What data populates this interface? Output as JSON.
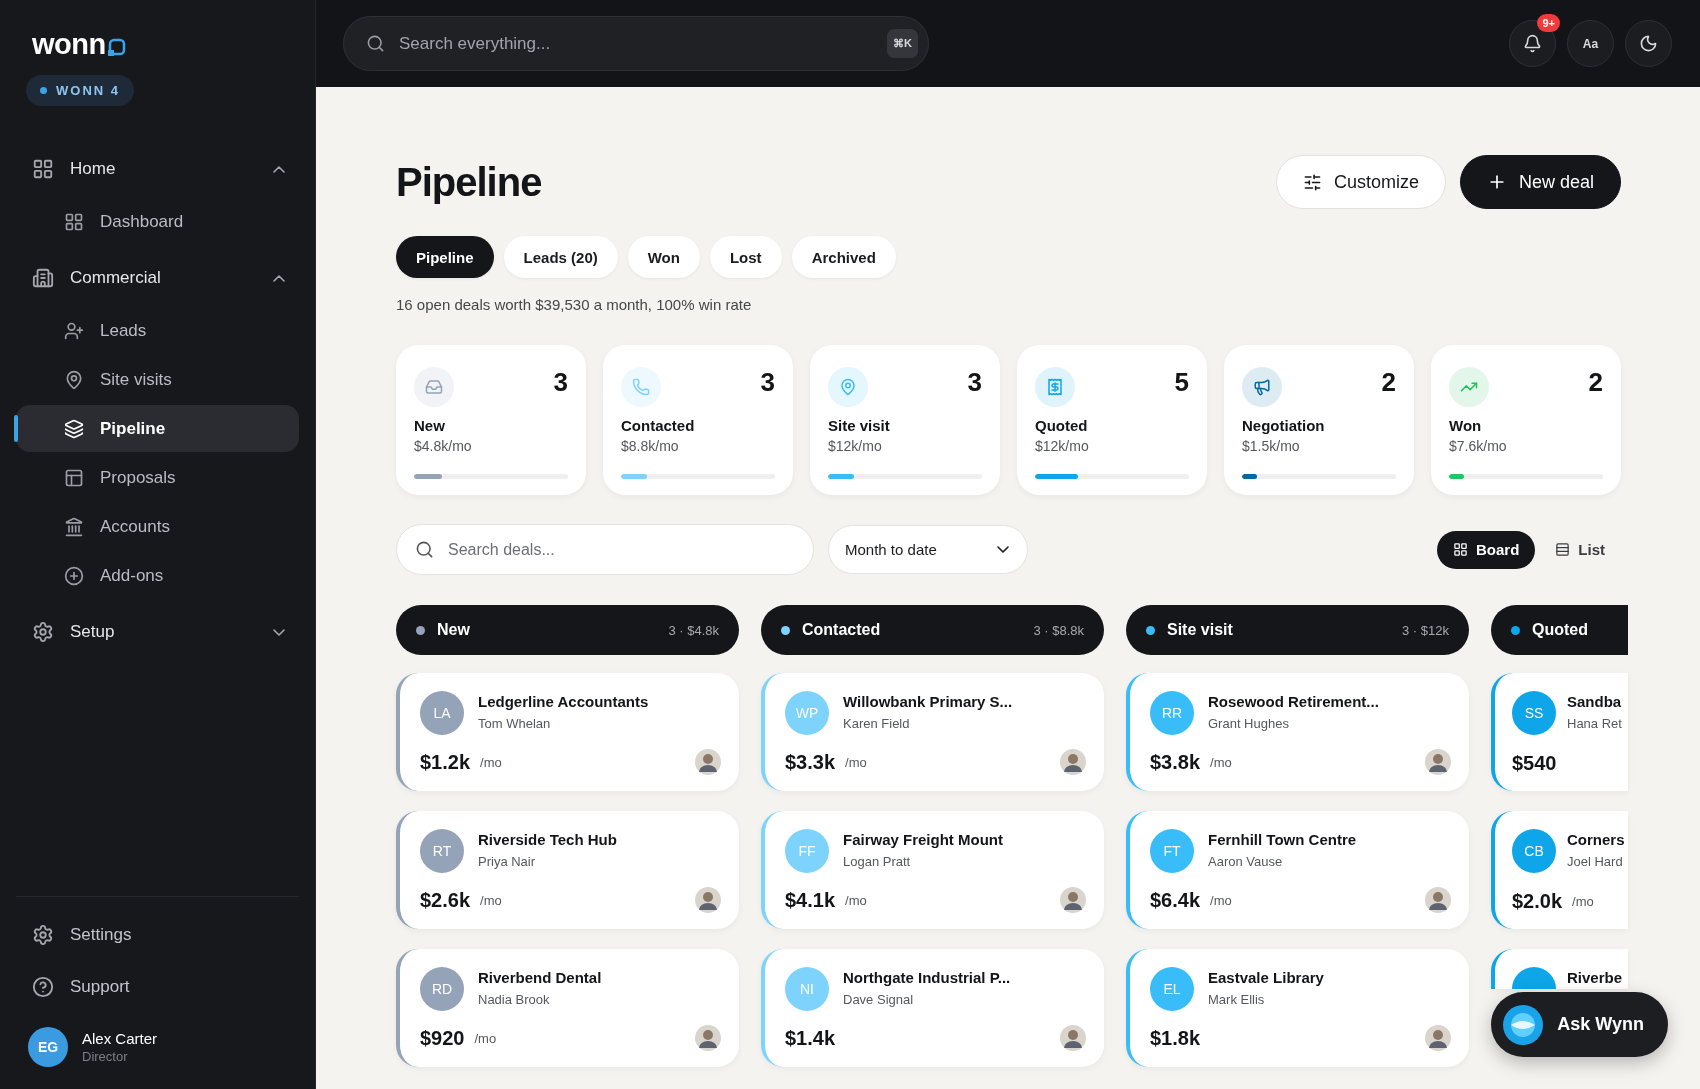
{
  "brand": {
    "logo": "wonn",
    "badge": "WONN 4"
  },
  "sidebar": {
    "groups": [
      {
        "label": "Home",
        "expanded": true,
        "children": [
          {
            "label": "Dashboard",
            "selected": false
          }
        ]
      },
      {
        "label": "Commercial",
        "expanded": true,
        "children": [
          {
            "label": "Leads",
            "selected": false
          },
          {
            "label": "Site visits",
            "selected": false
          },
          {
            "label": "Pipeline",
            "selected": true
          },
          {
            "label": "Proposals",
            "selected": false
          },
          {
            "label": "Accounts",
            "selected": false
          },
          {
            "label": "Add-ons",
            "selected": false
          }
        ]
      },
      {
        "label": "Setup",
        "expanded": false
      }
    ],
    "footer": [
      {
        "label": "Settings"
      },
      {
        "label": "Support"
      }
    ],
    "user": {
      "initials": "EG",
      "name": "Alex Carter",
      "role": "Director"
    }
  },
  "topbar": {
    "search": {
      "placeholder": "Search everything..."
    },
    "shortcut": "⌘K",
    "notifications": "9+",
    "font_button": "Aa"
  },
  "page": {
    "title": "Pipeline",
    "actions": [
      "Customize",
      "New deal"
    ],
    "tabs": [
      {
        "label": "Pipeline",
        "selected": true
      },
      {
        "label": "Leads (20)",
        "selected": false
      },
      {
        "label": "Won",
        "selected": false
      },
      {
        "label": "Lost",
        "selected": false
      },
      {
        "label": "Archived",
        "selected": false
      }
    ],
    "summary": "16 open deals worth $39,530 a month, 100% win rate"
  },
  "stages": [
    {
      "name": "New",
      "count": "3",
      "amount": "$4.8k/mo",
      "level": 0.18,
      "color": "#94a3b8"
    },
    {
      "name": "Contacted",
      "count": "3",
      "amount": "$8.8k/mo",
      "level": 0.17,
      "color": "#7dd3fc"
    },
    {
      "name": "Site visit",
      "count": "3",
      "amount": "$12k/mo",
      "level": 0.17,
      "color": "#38bdf8"
    },
    {
      "name": "Quoted",
      "count": "5",
      "amount": "$12k/mo",
      "level": 0.28,
      "color": "#0ea5e9"
    },
    {
      "name": "Negotiation",
      "count": "2",
      "amount": "$1.5k/mo",
      "level": 0.1,
      "color": "#0369a1"
    },
    {
      "name": "Won",
      "count": "2",
      "amount": "$7.6k/mo",
      "level": 0.1,
      "color": "#22c55e"
    }
  ],
  "filters": {
    "search": {
      "placeholder": "Search deals..."
    },
    "period": "Month to date",
    "views": [
      {
        "label": "Board",
        "selected": true
      },
      {
        "label": "List",
        "selected": false
      }
    ]
  },
  "board": [
    {
      "name": "New",
      "meta": "3 · $4.8k",
      "color": "#94a3b8",
      "deals": [
        {
          "initials": "LA",
          "company": "Ledgerline Accountants",
          "contact": "Tom Whelan",
          "value": "$1.2k",
          "unit": "/mo",
          "avatar": true
        },
        {
          "initials": "RT",
          "company": "Riverside Tech Hub",
          "contact": "Priya Nair",
          "value": "$2.6k",
          "unit": "/mo",
          "avatar": true
        },
        {
          "initials": "RD",
          "company": "Riverbend Dental",
          "contact": "Nadia Brook",
          "value": "$920",
          "unit": "/mo",
          "avatar": true
        }
      ]
    },
    {
      "name": "Contacted",
      "meta": "3 · $8.8k",
      "color": "#7dd3fc",
      "deals": [
        {
          "initials": "WP",
          "company": "Willowbank Primary S...",
          "contact": "Karen Field",
          "value": "$3.3k",
          "unit": "/mo",
          "avatar": true
        },
        {
          "initials": "FF",
          "company": "Fairway Freight Mount",
          "contact": "Logan Pratt",
          "value": "$4.1k",
          "unit": "/mo",
          "avatar": true
        },
        {
          "initials": "NI",
          "company": "Northgate Industrial P...",
          "contact": "Dave Signal",
          "value": "$1.4k",
          "avatar": true
        }
      ]
    },
    {
      "name": "Site visit",
      "meta": "3 · $12k",
      "color": "#38bdf8",
      "deals": [
        {
          "initials": "RR",
          "company": "Rosewood Retirement...",
          "contact": "Grant Hughes",
          "value": "$3.8k",
          "unit": "/mo",
          "avatar": true
        },
        {
          "initials": "FT",
          "company": "Fernhill Town Centre",
          "contact": "Aaron Vause",
          "value": "$6.4k",
          "unit": "/mo",
          "avatar": true
        },
        {
          "initials": "EL",
          "company": "Eastvale Library",
          "contact": "Mark Ellis",
          "value": "$1.8k",
          "avatar": true
        }
      ]
    },
    {
      "name": "Quoted",
      "color": "#0ea5e9",
      "deals": [
        {
          "initials": "SS",
          "company": "Sandba",
          "contact": "Hana Ret",
          "value": "$540",
          "avatar": false
        },
        {
          "initials": "CB",
          "company": "Corners",
          "contact": "Joel Hard",
          "value": "$2.0k",
          "unit": "/mo",
          "avatar": false
        },
        {
          "company": "Riverbe"
        }
      ]
    }
  ],
  "assistant": {
    "label": "Ask Wynn"
  }
}
